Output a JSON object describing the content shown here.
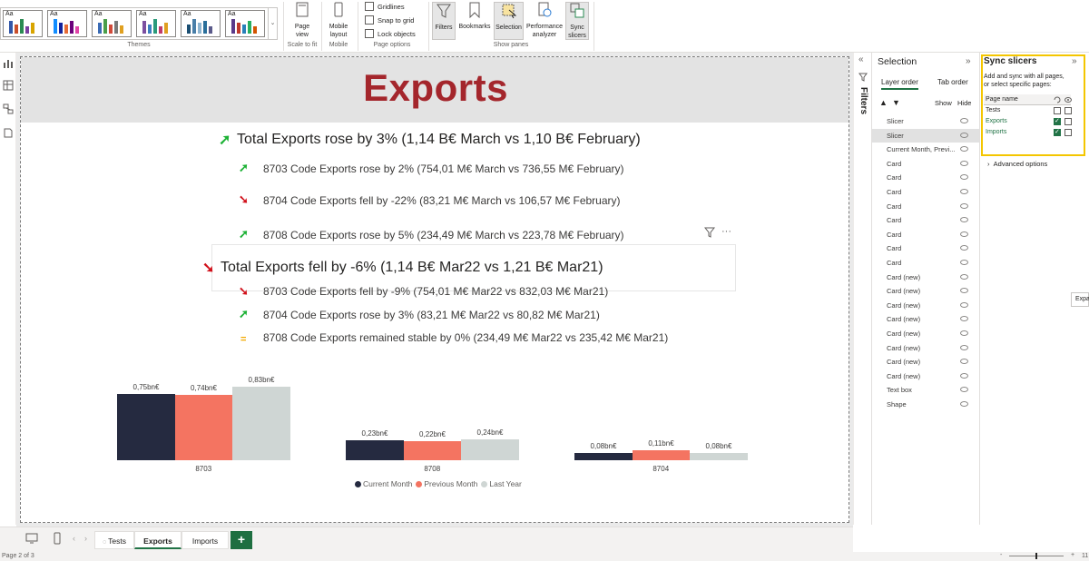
{
  "ribbon": {
    "themes_label": "Themes",
    "theme_thumb_text": "Aa",
    "page_view_label": "Page view",
    "scale_label": "Scale to fit",
    "mobile_layout_label": "Mobile layout",
    "mobile_group_label": "Mobile",
    "gridlines_label": "Gridlines",
    "snap_label": "Snap to grid",
    "lock_label": "Lock objects",
    "page_options_label": "Page options",
    "filters_label": "Filters",
    "bookmarks_label": "Bookmarks",
    "selection_label": "Selection",
    "performance_label": "Performance analyzer",
    "sync_slicers_label": "Sync slicers",
    "show_panes_label": "Show panes"
  },
  "report": {
    "title": "Exports",
    "month_main": "Total Exports rose by 3% (1,14 B€ March vs 1,10 B€ February)",
    "month_items": [
      {
        "direction": "up",
        "text": "8703 Code Exports rose by 2% (754,01 M€ March vs 736,55 M€ February)"
      },
      {
        "direction": "down",
        "text": "8704 Code Exports fell by -22% (83,21 M€ March vs 106,57 M€ February)"
      },
      {
        "direction": "up",
        "text": "8708 Code Exports rose by 5% (234,49 M€ March vs 223,78 M€ February)"
      }
    ],
    "year_main": "Total Exports fell by -6% (1,14 B€ Mar22 vs 1,21 B€ Mar21)",
    "year_items": [
      {
        "direction": "down",
        "text": "8703 Code Exports fell by -9% (754,01 M€ Mar22 vs 832,03 M€ Mar21)"
      },
      {
        "direction": "up",
        "text": "8704 Code Exports rose by 3% (83,21 M€ Mar22 vs 80,82 M€ Mar21)"
      },
      {
        "direction": "equal",
        "text": "8708 Code Exports remained stable by 0% (234,49 M€ Mar22 vs 235,42 M€ Mar21)"
      }
    ],
    "arrow_up": "➚",
    "arrow_down": "➘",
    "arrow_equal": "=",
    "visual_more": "···"
  },
  "chart_data": {
    "type": "bar",
    "categories": [
      "8703",
      "8708",
      "8704"
    ],
    "series": [
      {
        "name": "Current Month",
        "color": "#252a40",
        "values": [
          0.75,
          0.23,
          0.08
        ],
        "labels": [
          "0,75bn€",
          "0,23bn€",
          "0,08bn€"
        ]
      },
      {
        "name": "Previous Month",
        "color": "#f47461",
        "values": [
          0.74,
          0.22,
          0.11
        ],
        "labels": [
          "0,74bn€",
          "0,22bn€",
          "0,11bn€"
        ]
      },
      {
        "name": "Last Year",
        "color": "#cfd6d4",
        "values": [
          0.83,
          0.24,
          0.08
        ],
        "labels": [
          "0,83bn€",
          "0,24bn€",
          "0,08bn€"
        ]
      }
    ],
    "unit": "bn€",
    "legend_position": "bottom"
  },
  "filters_pane": {
    "label": "Filters"
  },
  "selection_pane": {
    "title": "Selection",
    "tab_layer_order": "Layer order",
    "tab_tab_order": "Tab order",
    "show_label": "Show",
    "hide_label": "Hide",
    "items": [
      "Slicer",
      "Slicer",
      "Current Month, Previ...",
      "Card",
      "Card",
      "Card",
      "Card",
      "Card",
      "Card",
      "Card",
      "Card",
      "Card (new)",
      "Card (new)",
      "Card (new)",
      "Card (new)",
      "Card (new)",
      "Card (new)",
      "Card (new)",
      "Card (new)",
      "Text box",
      "Shape"
    ]
  },
  "sync_pane": {
    "title": "Sync slicers",
    "description": "Add and sync with all pages, or select specific pages:",
    "column_page_name": "Page name",
    "pages": [
      {
        "name": "Tests",
        "sync": false,
        "visible": false
      },
      {
        "name": "Exports",
        "sync": true,
        "visible": false
      },
      {
        "name": "Imports",
        "sync": true,
        "visible": false
      }
    ],
    "advanced_options": "Advanced options",
    "tooltip": "Expa"
  },
  "pages_bar": {
    "tabs": [
      "Tests",
      "Exports",
      "Imports"
    ],
    "active_tab": "Exports",
    "add_label": "+"
  },
  "status": {
    "page_info": "Page 2 of 3",
    "zoom_minus": "-",
    "zoom_plus": "+",
    "zoom_partial": "11"
  }
}
